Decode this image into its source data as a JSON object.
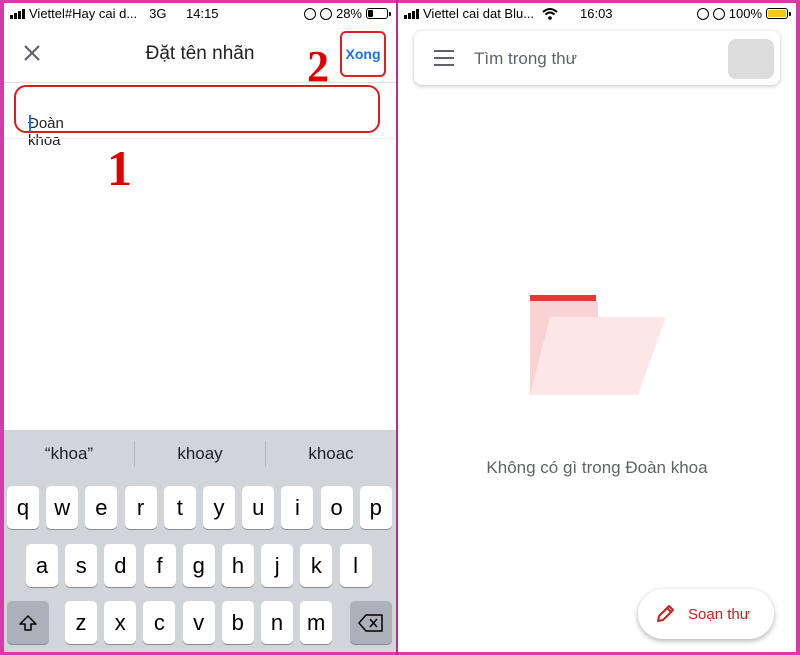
{
  "left_status": {
    "carrier": "Viettel#Hay cai d...",
    "network": "3G",
    "time": "14:15",
    "battery": "28%"
  },
  "right_status": {
    "carrier": "Viettel cai dat Blu...",
    "time": "16:03",
    "battery": "100%"
  },
  "label_screen": {
    "title": "Đặt tên nhãn",
    "done_label": "Xong",
    "input_value": "Đoàn khoa",
    "annotation_1": "1",
    "annotation_2": "2"
  },
  "keyboard": {
    "suggestions": [
      "“khoa”",
      "khoay",
      "khoac"
    ],
    "row1": [
      "q",
      "w",
      "e",
      "r",
      "t",
      "y",
      "u",
      "i",
      "o",
      "p"
    ],
    "row2": [
      "a",
      "s",
      "d",
      "f",
      "g",
      "h",
      "j",
      "k",
      "l"
    ],
    "row3": [
      "z",
      "x",
      "c",
      "v",
      "b",
      "n",
      "m"
    ]
  },
  "inbox_screen": {
    "search_placeholder": "Tìm trong thư",
    "empty_message": "Không có gì trong Đoàn khoa",
    "compose_label": "Soạn thư"
  },
  "colors": {
    "accent": "#1a73e8",
    "annotation": "#e00000",
    "compose": "#c5221f",
    "frame": "#d63ca8"
  }
}
